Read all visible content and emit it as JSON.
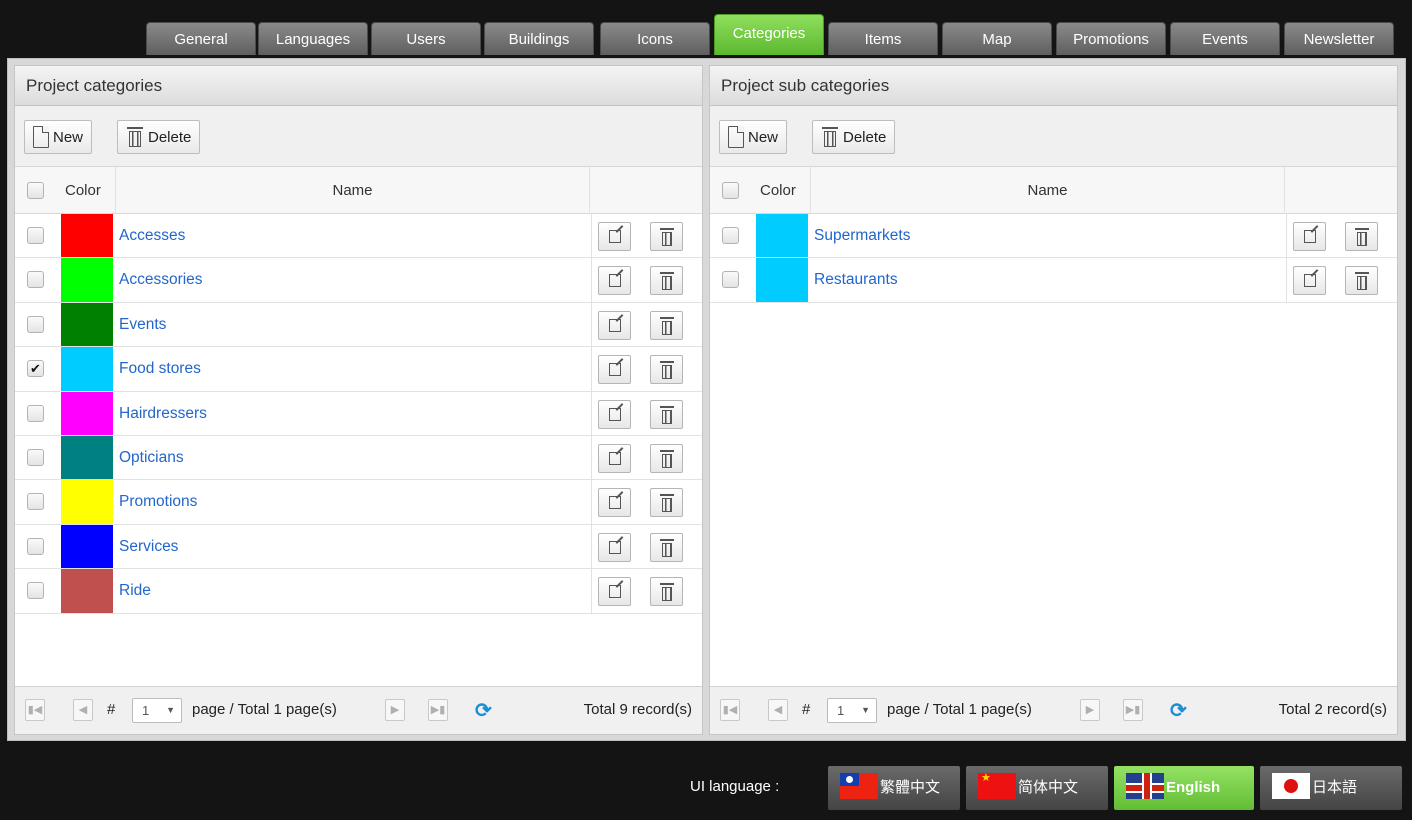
{
  "tabs": [
    {
      "label": "General"
    },
    {
      "label": "Languages"
    },
    {
      "label": "Users"
    },
    {
      "label": "Buildings"
    },
    {
      "label": "Icons"
    },
    {
      "label": "Categories",
      "active": true
    },
    {
      "label": "Items"
    },
    {
      "label": "Map"
    },
    {
      "label": "Promotions"
    },
    {
      "label": "Events"
    },
    {
      "label": "Newsletter"
    }
  ],
  "left": {
    "title": "Project categories",
    "new_label": "New",
    "delete_label": "Delete",
    "col_color": "Color",
    "col_name": "Name",
    "rows": [
      {
        "name": "Accesses",
        "color": "#ff0000",
        "checked": false
      },
      {
        "name": "Accessories",
        "color": "#00ff00",
        "checked": false
      },
      {
        "name": "Events",
        "color": "#008000",
        "checked": false
      },
      {
        "name": "Food stores",
        "color": "#00ccff",
        "checked": true
      },
      {
        "name": "Hairdressers",
        "color": "#ff00ff",
        "checked": false
      },
      {
        "name": "Opticians",
        "color": "#008080",
        "checked": false
      },
      {
        "name": "Promotions",
        "color": "#ffff00",
        "checked": false
      },
      {
        "name": "Services",
        "color": "#0000ff",
        "checked": false
      },
      {
        "name": "Ride",
        "color": "#c0504d",
        "checked": false
      }
    ],
    "pager": {
      "hash": "#",
      "page": "1",
      "page_text": "page /  Total 1 page(s)",
      "total": "Total 9 record(s)"
    }
  },
  "right": {
    "title": "Project sub categories",
    "new_label": "New",
    "delete_label": "Delete",
    "col_color": "Color",
    "col_name": "Name",
    "rows": [
      {
        "name": "Supermarkets",
        "color": "#00ccff",
        "checked": false
      },
      {
        "name": "Restaurants",
        "color": "#00ccff",
        "checked": false
      }
    ],
    "pager": {
      "hash": "#",
      "page": "1",
      "page_text": "page /  Total 1 page(s)",
      "total": "Total 2 record(s)"
    }
  },
  "footer": {
    "ui_language_label": "UI language :",
    "languages": [
      {
        "label": "繁體中文",
        "flag": "taiwan-flag-icon"
      },
      {
        "label": "简体中文",
        "flag": "china-flag-icon"
      },
      {
        "label": "English",
        "flag": "uk-flag-icon",
        "active": true
      },
      {
        "label": "日本語",
        "flag": "japan-flag-icon"
      }
    ]
  }
}
